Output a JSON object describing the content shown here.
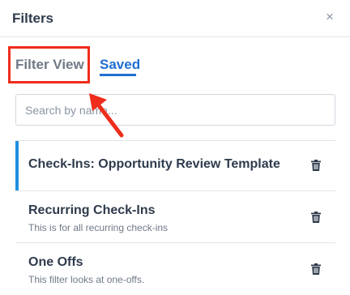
{
  "header": {
    "title": "Filters",
    "close_label": "×"
  },
  "tabs": [
    {
      "label": "Filter View",
      "active": false,
      "highlighted": true
    },
    {
      "label": "Saved",
      "active": true
    }
  ],
  "search": {
    "placeholder": "Search by name...",
    "value": ""
  },
  "annotation": {
    "arrow_color": "#ef2d1c",
    "highlight_color": "#ef2d1c"
  },
  "saved_filters": [
    {
      "title": "Check-Ins: Opportunity Review Template",
      "description": "",
      "selected": true,
      "icon": "trash-icon"
    },
    {
      "title": "Recurring Check-Ins",
      "description": "This is for all recurring check-ins",
      "selected": false,
      "icon": "trash-icon"
    },
    {
      "title": "One Offs",
      "description": "This filter looks at one-offs.",
      "selected": false,
      "icon": "trash-icon"
    }
  ],
  "colors": {
    "accent": "#1f6fd1",
    "selected_bar": "#1f8fe0",
    "text": "#2f3b4c",
    "muted": "#6f7986"
  }
}
